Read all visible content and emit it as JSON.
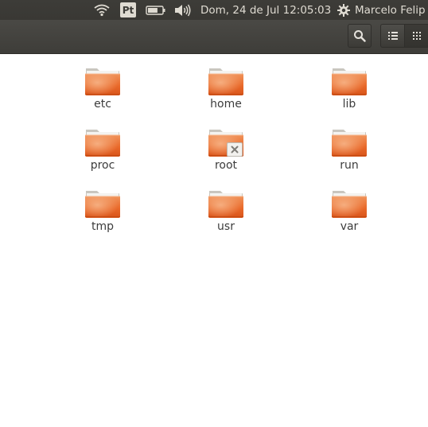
{
  "topbar": {
    "keyboard_layout": "Pt",
    "datetime": "Dom, 24 de Jul 12:05:03",
    "username": "Marcelo Felip",
    "icons": [
      "wifi-icon",
      "battery-icon",
      "volume-icon",
      "gear-icon"
    ],
    "battery_level": 0.7
  },
  "toolbar": {
    "icons": [
      "search-icon",
      "list-view-icon",
      "grid-view-icon"
    ],
    "active_view": "grid"
  },
  "files": {
    "items": [
      {
        "label": "etc"
      },
      {
        "label": "home"
      },
      {
        "label": "lib"
      },
      {
        "label": "proc"
      },
      {
        "label": "root",
        "emblem": "no-access-emblem"
      },
      {
        "label": "run"
      },
      {
        "label": "tmp"
      },
      {
        "label": "usr"
      },
      {
        "label": "var"
      }
    ]
  },
  "colors": {
    "panel_bg": "#3c3b37",
    "folder_orange": "#e8601f",
    "folder_light": "#f3a16a",
    "panel_text": "#dfdbd2"
  }
}
